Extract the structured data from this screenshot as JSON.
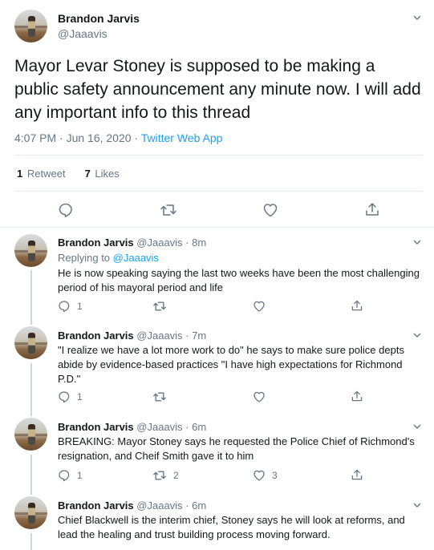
{
  "main_tweet": {
    "name": "Brandon Jarvis",
    "handle": "@Jaaavis",
    "text": "Mayor Levar Stoney is supposed to be making a public safety announcement any minute now. I will add any important info to this thread",
    "time": "4:07 PM · Jun 16, 2020 · ",
    "source": "Twitter Web App",
    "retweets_count": "1",
    "retweets_label": "Retweet",
    "likes_count": "7",
    "likes_label": "Likes"
  },
  "replies": [
    {
      "name": "Brandon Jarvis",
      "handle": "@Jaaavis · 8m",
      "replying_prefix": "Replying to ",
      "replying_to": "@Jaaavis",
      "text": "He is now speaking saying the last two weeks have been the most challenging period of his mayoral period and life",
      "reply_count": "1",
      "retweet_count": "",
      "like_count": ""
    },
    {
      "name": "Brandon Jarvis",
      "handle": "@Jaaavis · 7m",
      "text": "\"I realize we have a lot more work to do\" he says to make sure police depts abide by evidence-based practices \"I have high expectations for Richmond P.D.\"",
      "reply_count": "1",
      "retweet_count": "",
      "like_count": ""
    },
    {
      "name": "Brandon Jarvis",
      "handle": "@Jaaavis · 6m",
      "text": "BREAKING: Mayor Stoney says he requested the Police Chief of Richmond's resignation, and Cheif Smith gave it to him",
      "reply_count": "1",
      "retweet_count": "2",
      "like_count": "3"
    },
    {
      "name": "Brandon Jarvis",
      "handle": "@Jaaavis · 6m",
      "text": "Chief Blackwell is the interim chief, Stoney says he will look at reforms, and lead the healing and trust building process moving forward."
    }
  ],
  "icons": {
    "reply": "reply-icon",
    "retweet": "retweet-icon",
    "like": "heart-icon",
    "share": "share-icon",
    "more": "chevron-down-icon"
  },
  "colors": {
    "accent": "#1da1f2",
    "secondary_text": "#657786",
    "divider": "#e6ecf0"
  }
}
